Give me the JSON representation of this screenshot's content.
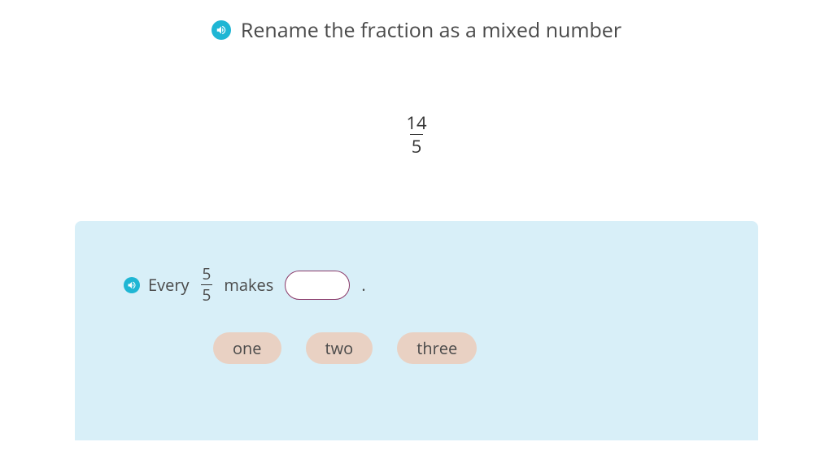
{
  "header": {
    "title": "Rename the fraction as a mixed number"
  },
  "problem": {
    "numerator": "14",
    "denominator": "5"
  },
  "prompt": {
    "text_before": "Every",
    "fraction_num": "5",
    "fraction_denom": "5",
    "text_after": "makes",
    "text_end": "."
  },
  "options": [
    "one",
    "two",
    "three"
  ]
}
